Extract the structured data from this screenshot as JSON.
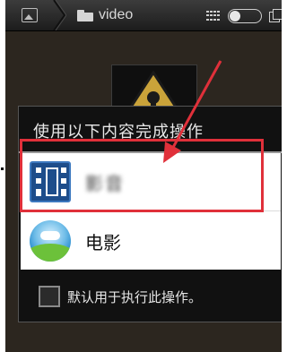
{
  "topbar": {
    "folder_name": "video",
    "icons": [
      "gallery-icon",
      "folder-icon",
      "grid-icon",
      "toggle-switch",
      "cards-icon"
    ]
  },
  "dialog": {
    "title": "使用以下内容完成操作",
    "apps": [
      {
        "label": "影音",
        "icon": "video-player-icon",
        "highlighted": true
      },
      {
        "label": "电影",
        "icon": "movie-app-icon",
        "highlighted": false
      }
    ],
    "default_checkbox_label": "默认用于执行此操作。",
    "default_checked": false
  },
  "annotation_colors": {
    "highlight": "#e0303a"
  }
}
